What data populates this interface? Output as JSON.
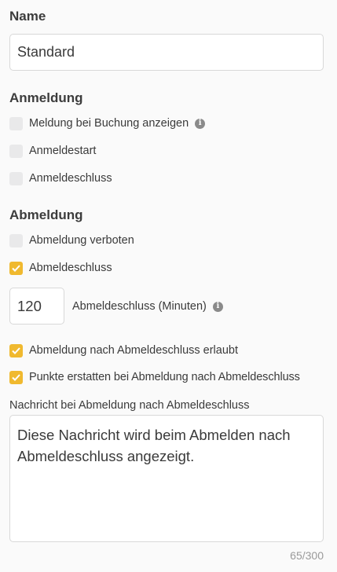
{
  "name": {
    "heading": "Name",
    "value": "Standard"
  },
  "anmeldung": {
    "heading": "Anmeldung",
    "options": [
      {
        "label": "Meldung bei Buchung anzeigen",
        "checked": false,
        "info": true
      },
      {
        "label": "Anmeldestart",
        "checked": false
      },
      {
        "label": "Anmeldeschluss",
        "checked": false
      }
    ]
  },
  "abmeldung": {
    "heading": "Abmeldung",
    "verboten_label": "Abmeldung verboten",
    "schluss_label": "Abmeldeschluss",
    "minutes_value": "120",
    "minutes_label": "Abmeldeschluss (Minuten)",
    "erlaubt_label": "Abmeldung nach Abmeldeschluss erlaubt",
    "punkte_label": "Punkte erstatten bei Abmeldung nach Abmeldeschluss",
    "message_label": "Nachricht bei Abmeldung nach Abmeldeschluss",
    "message_value": "Diese Nachricht wird beim Abmelden nach Abmeldeschluss angezeigt.",
    "char_count": "65/300"
  },
  "colors": {
    "accent": "#f0b92f",
    "checkbox_unchecked": "#e9e9ea",
    "info_icon": "#8a8a8a"
  },
  "icons": [
    "check-icon",
    "info-icon"
  ]
}
